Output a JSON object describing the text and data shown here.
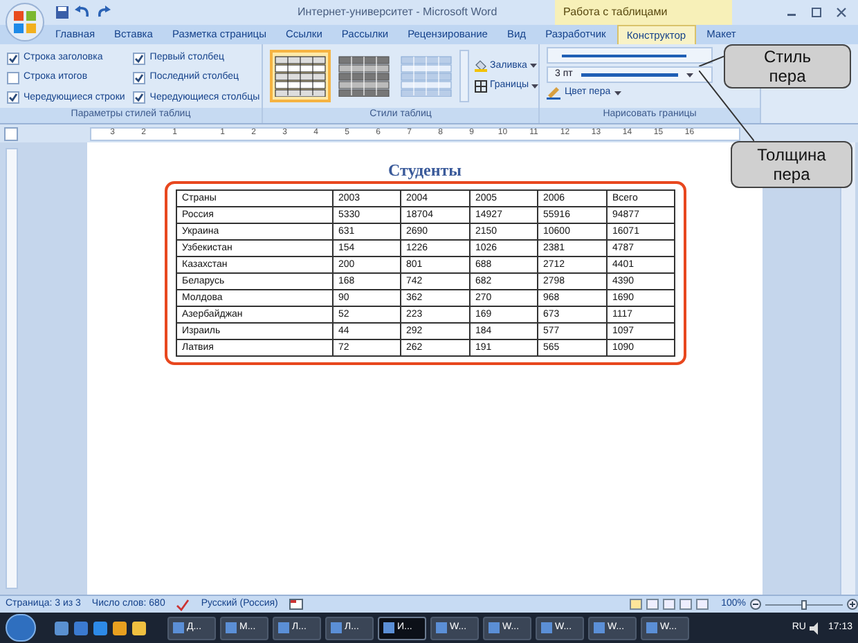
{
  "window": {
    "title": "Интернет-университет - Microsoft Word",
    "contextual_tab": "Работа с таблицами"
  },
  "tabs": [
    {
      "label": "Главная",
      "selected": false
    },
    {
      "label": "Вставка",
      "selected": false
    },
    {
      "label": "Разметка страницы",
      "selected": false
    },
    {
      "label": "Ссылки",
      "selected": false
    },
    {
      "label": "Рассылки",
      "selected": false
    },
    {
      "label": "Рецензирование",
      "selected": false
    },
    {
      "label": "Вид",
      "selected": false
    },
    {
      "label": "Разработчик",
      "selected": false
    },
    {
      "label": "Конструктор",
      "selected": true
    },
    {
      "label": "Макет",
      "selected": false
    }
  ],
  "ribbon": {
    "style_options": {
      "title": "Параметры стилей таблиц",
      "options": [
        {
          "label": "Строка заголовка",
          "checked": true
        },
        {
          "label": "Строка итогов",
          "checked": false
        },
        {
          "label": "Чередующиеся строки",
          "checked": true
        },
        {
          "label": "Первый столбец",
          "checked": true
        },
        {
          "label": "Последний столбец",
          "checked": true
        },
        {
          "label": "Чередующиеся столбцы",
          "checked": true
        }
      ]
    },
    "table_styles": {
      "title": "Стили таблиц",
      "gallery": [
        {
          "selected": true
        },
        {
          "selected": false
        },
        {
          "selected": false
        }
      ],
      "buttons": [
        "Заливка",
        "Границы"
      ]
    },
    "draw_borders": {
      "title": "Нарисовать границы",
      "pen_weight": "3 пт",
      "pen_color": "Цвет пера"
    }
  },
  "callouts": [
    "Стиль пера",
    "Толщина пера"
  ],
  "ruler": [
    "3",
    "2",
    "1",
    "1",
    "2",
    "3",
    "4",
    "5",
    "6",
    "7",
    "8",
    "9",
    "10",
    "11",
    "12",
    "13",
    "14",
    "15",
    "16"
  ],
  "document": {
    "heading": "Студенты",
    "table": {
      "rows": [
        [
          "Страны",
          "2003",
          "2004",
          "2005",
          "2006",
          "Всего"
        ],
        [
          "Россия",
          "5330",
          "18704",
          "14927",
          "55916",
          "94877"
        ],
        [
          "Украина",
          "631",
          "2690",
          "2150",
          "10600",
          "16071"
        ],
        [
          "Узбекистан",
          "154",
          "1226",
          "1026",
          "2381",
          "4787"
        ],
        [
          "Казахстан",
          "200",
          "801",
          "688",
          "2712",
          "4401"
        ],
        [
          "Беларусь",
          "168",
          "742",
          "682",
          "2798",
          "4390"
        ],
        [
          "Молдова",
          "90",
          "362",
          "270",
          "968",
          "1690"
        ],
        [
          "Азербайджан",
          "52",
          "223",
          "169",
          "673",
          "1117"
        ],
        [
          "Израиль",
          "44",
          "292",
          "184",
          "577",
          "1097"
        ],
        [
          "Латвия",
          "72",
          "262",
          "191",
          "565",
          "1090"
        ]
      ]
    }
  },
  "status_bar": {
    "page": "Страница: 3 из 3",
    "words": "Число слов: 680",
    "language": "Русский (Россия)",
    "zoom": "100%",
    "zoom_slider": {
      "level": 0.5
    }
  },
  "taskbar": {
    "items": [
      {
        "label": "Д...",
        "selected": false
      },
      {
        "label": "М...",
        "selected": false
      },
      {
        "label": "Л...",
        "selected": false
      },
      {
        "label": "Л...",
        "selected": false
      },
      {
        "label": "И...",
        "selected": true
      },
      {
        "label": "W...",
        "selected": false
      },
      {
        "label": "W...",
        "selected": false
      },
      {
        "label": "W...",
        "selected": false
      },
      {
        "label": "W...",
        "selected": false
      },
      {
        "label": "W...",
        "selected": false
      }
    ],
    "language": "RU",
    "time": "17:13"
  }
}
